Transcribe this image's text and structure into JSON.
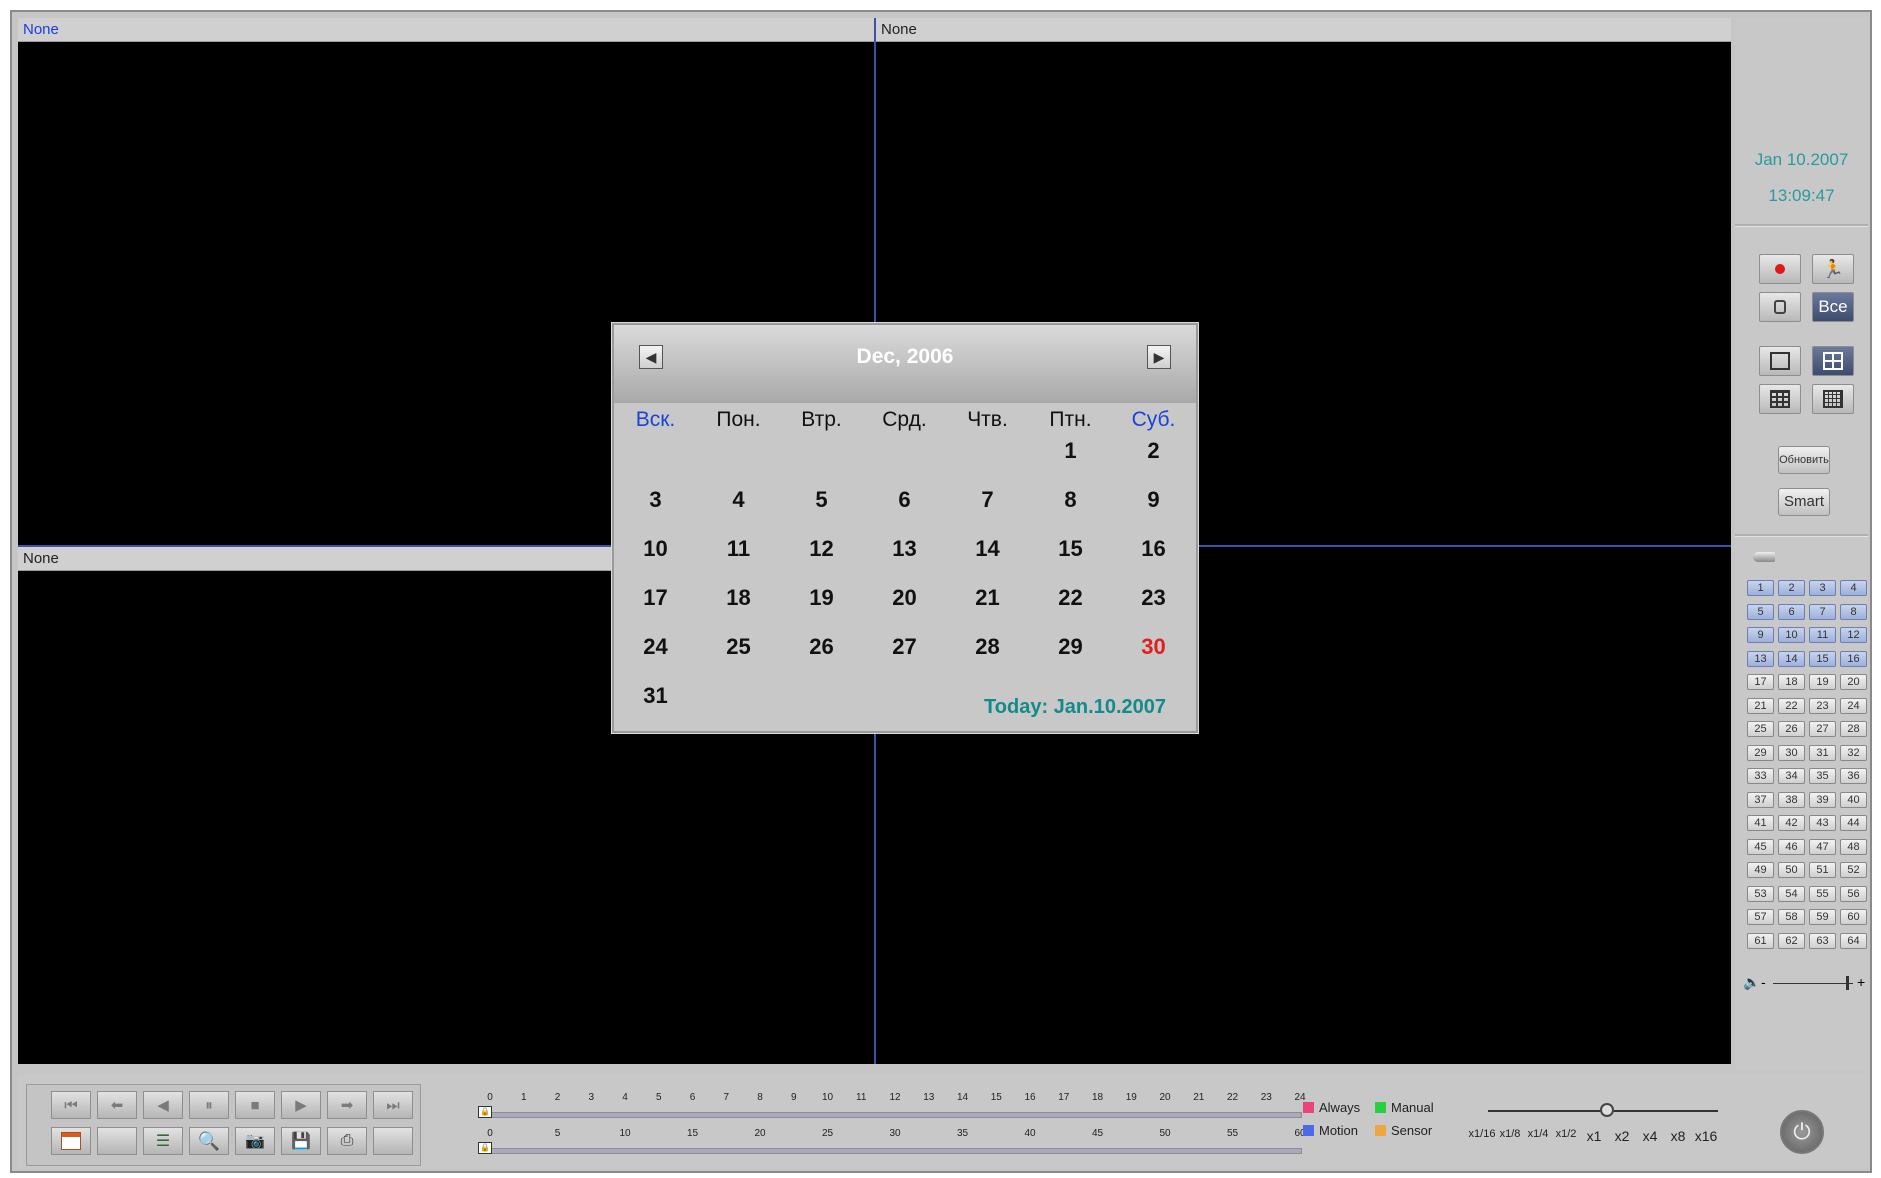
{
  "panes": [
    {
      "label": "None"
    },
    {
      "label": "None"
    },
    {
      "label": "None"
    }
  ],
  "clock": {
    "date": "Jan 10.2007",
    "time": "13:09:47"
  },
  "sidebar": {
    "all_label": "Все",
    "refresh_label": "Обновить",
    "smart_label": "Smart",
    "channels": [
      "1",
      "2",
      "3",
      "4",
      "5",
      "6",
      "7",
      "8",
      "9",
      "10",
      "11",
      "12",
      "13",
      "14",
      "15",
      "16",
      "17",
      "18",
      "19",
      "20",
      "21",
      "22",
      "23",
      "24",
      "25",
      "26",
      "27",
      "28",
      "29",
      "30",
      "31",
      "32",
      "33",
      "34",
      "35",
      "36",
      "37",
      "38",
      "39",
      "40",
      "41",
      "42",
      "43",
      "44",
      "45",
      "46",
      "47",
      "48",
      "49",
      "50",
      "51",
      "52",
      "53",
      "54",
      "55",
      "56",
      "57",
      "58",
      "59",
      "60",
      "61",
      "62",
      "63",
      "64"
    ],
    "selected_channels_count": 16,
    "volume_minus": "-",
    "volume_plus": "+"
  },
  "timeline": {
    "hours": [
      "0",
      "1",
      "2",
      "3",
      "4",
      "5",
      "6",
      "7",
      "8",
      "9",
      "10",
      "11",
      "12",
      "13",
      "14",
      "15",
      "16",
      "17",
      "18",
      "19",
      "20",
      "21",
      "22",
      "23",
      "24"
    ],
    "minutes": [
      "0",
      "5",
      "10",
      "15",
      "20",
      "25",
      "30",
      "35",
      "40",
      "45",
      "50",
      "55",
      "60"
    ]
  },
  "legend": [
    {
      "label": "Always",
      "color": "#e8457a"
    },
    {
      "label": "Manual",
      "color": "#28d040"
    },
    {
      "label": "Motion",
      "color": "#4a6ae8"
    },
    {
      "label": "Sensor",
      "color": "#f0a640"
    }
  ],
  "speed": {
    "labels": [
      "x1/16",
      "x1/8",
      "x1/4",
      "x1/2",
      "x1",
      "x2",
      "x4",
      "x8",
      "x16"
    ],
    "current": "x1"
  },
  "calendar": {
    "title": "Dec, 2006",
    "weekdays": [
      "Вск.",
      "Пон.",
      "Втр.",
      "Срд.",
      "Чтв.",
      "Птн.",
      "Суб."
    ],
    "first_weekday_index": 5,
    "days_in_month": 31,
    "highlight_day": 30,
    "today_text": "Today: Jan.10.2007"
  }
}
